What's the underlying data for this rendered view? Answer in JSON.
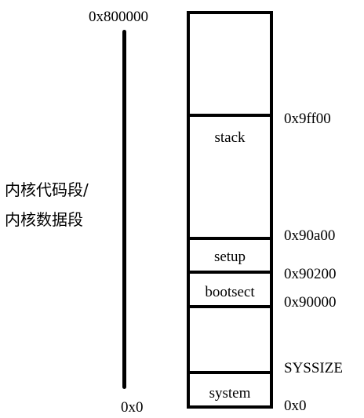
{
  "top_address": "0x800000",
  "bottom_address": "0x0",
  "side_label": {
    "line1": "内核代码段/",
    "line2": "内核数据段"
  },
  "regions": {
    "stack": "stack",
    "setup": "setup",
    "bootsect": "bootsect",
    "system": "system"
  },
  "addresses": {
    "stack_top": "0x9ff00",
    "setup_top": "0x90a00",
    "bootsect_top": "0x90200",
    "bootsect_bottom": "0x90000",
    "system_top": "SYSSIZE",
    "base": "0x0"
  }
}
